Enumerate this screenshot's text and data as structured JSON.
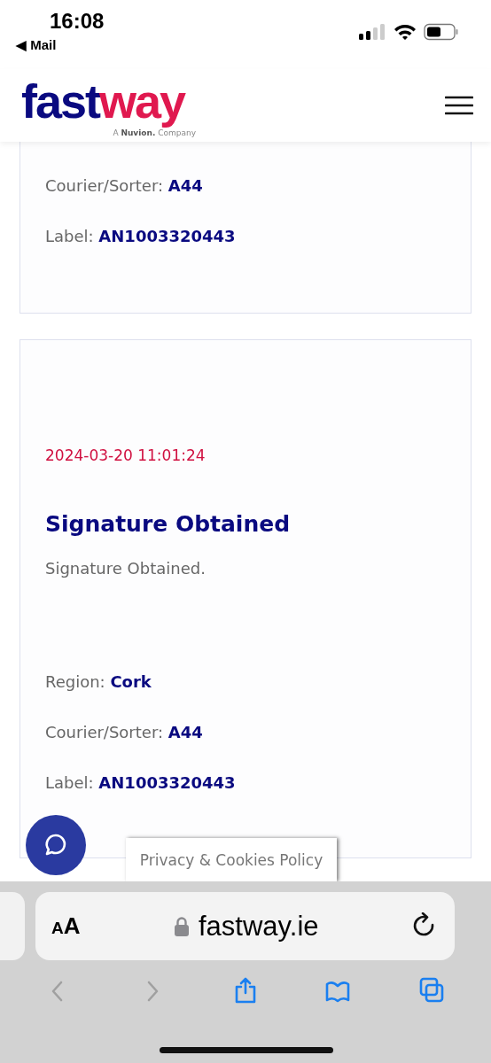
{
  "status_bar": {
    "time": "16:08",
    "back_link": "◀ Mail"
  },
  "header": {
    "logo": {
      "part_1": "fast",
      "part_2": "way",
      "tagline": "A **Nuvion.** Company"
    }
  },
  "cards": [
    {
      "partial": true,
      "fields": [
        {
          "label": "Courier/Sorter:",
          "value": "A44"
        },
        {
          "label": "Label:",
          "value": "AN1003320443"
        }
      ]
    },
    {
      "partial": false,
      "datetime": "2024-03-20 11:01:24",
      "title": "Signature Obtained",
      "description": "Signature Obtained.",
      "fields": [
        {
          "label": "Region:",
          "value": "Cork"
        },
        {
          "label": "Courier/Sorter:",
          "value": "A44"
        },
        {
          "label": "Label:",
          "value": "AN1003320443"
        }
      ]
    }
  ],
  "privacy_tab": "Privacy & Cookies Policy",
  "browser": {
    "text_size_button": "AA",
    "url": "fastway.ie",
    "toolbar": [
      {
        "kind": "back",
        "disabled": true
      },
      {
        "kind": "forward",
        "disabled": true
      },
      {
        "kind": "share",
        "disabled": false
      },
      {
        "kind": "bookmarks",
        "disabled": false
      },
      {
        "kind": "tabs",
        "disabled": false
      }
    ]
  }
}
